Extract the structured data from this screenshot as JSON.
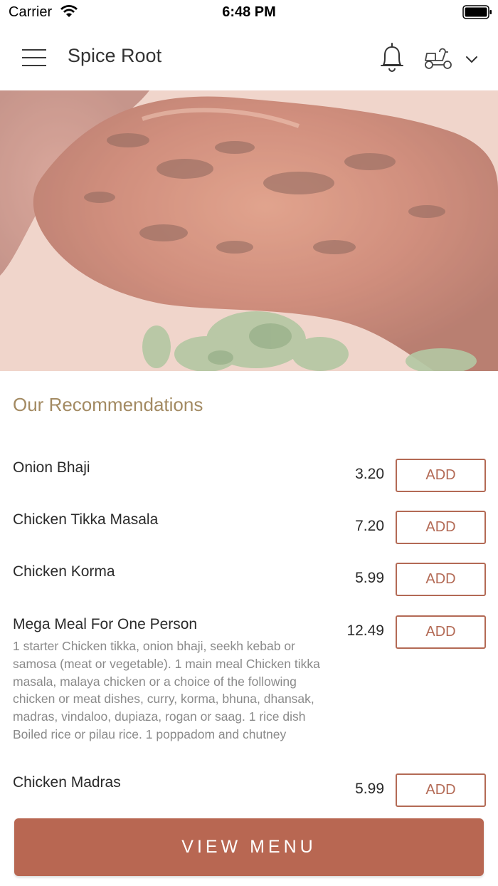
{
  "status_bar": {
    "carrier": "Carrier",
    "time": "6:48 PM"
  },
  "header": {
    "title": "Spice Root",
    "icons": [
      "menu-icon",
      "bell-icon",
      "scooter-icon",
      "chevron-down-icon"
    ]
  },
  "recommendations": {
    "title": "Our Recommendations",
    "add_label": "ADD",
    "items": [
      {
        "name": "Onion Bhaji",
        "price": "3.20",
        "description": ""
      },
      {
        "name": "Chicken Tikka Masala",
        "price": "7.20",
        "description": ""
      },
      {
        "name": "Chicken Korma",
        "price": "5.99",
        "description": ""
      },
      {
        "name": "Mega Meal For One Person",
        "price": "12.49",
        "description": "1 starter Chicken tikka, onion bhaji, seekh kebab or samosa (meat or vegetable). 1 main meal Chicken tikka masala, malaya chicken or a choice of the following chicken or meat dishes, curry, korma, bhuna, dhansak, madras, vindaloo, dupiaza, rogan or saag. 1 rice dish Boiled rice or pilau rice. 1 poppadom and chutney"
      },
      {
        "name": "Chicken Madras",
        "price": "5.99",
        "description": ""
      }
    ]
  },
  "view_menu_label": "VIEW MENU",
  "colors": {
    "accent": "#b86752",
    "title_gold": "#a38a62"
  }
}
